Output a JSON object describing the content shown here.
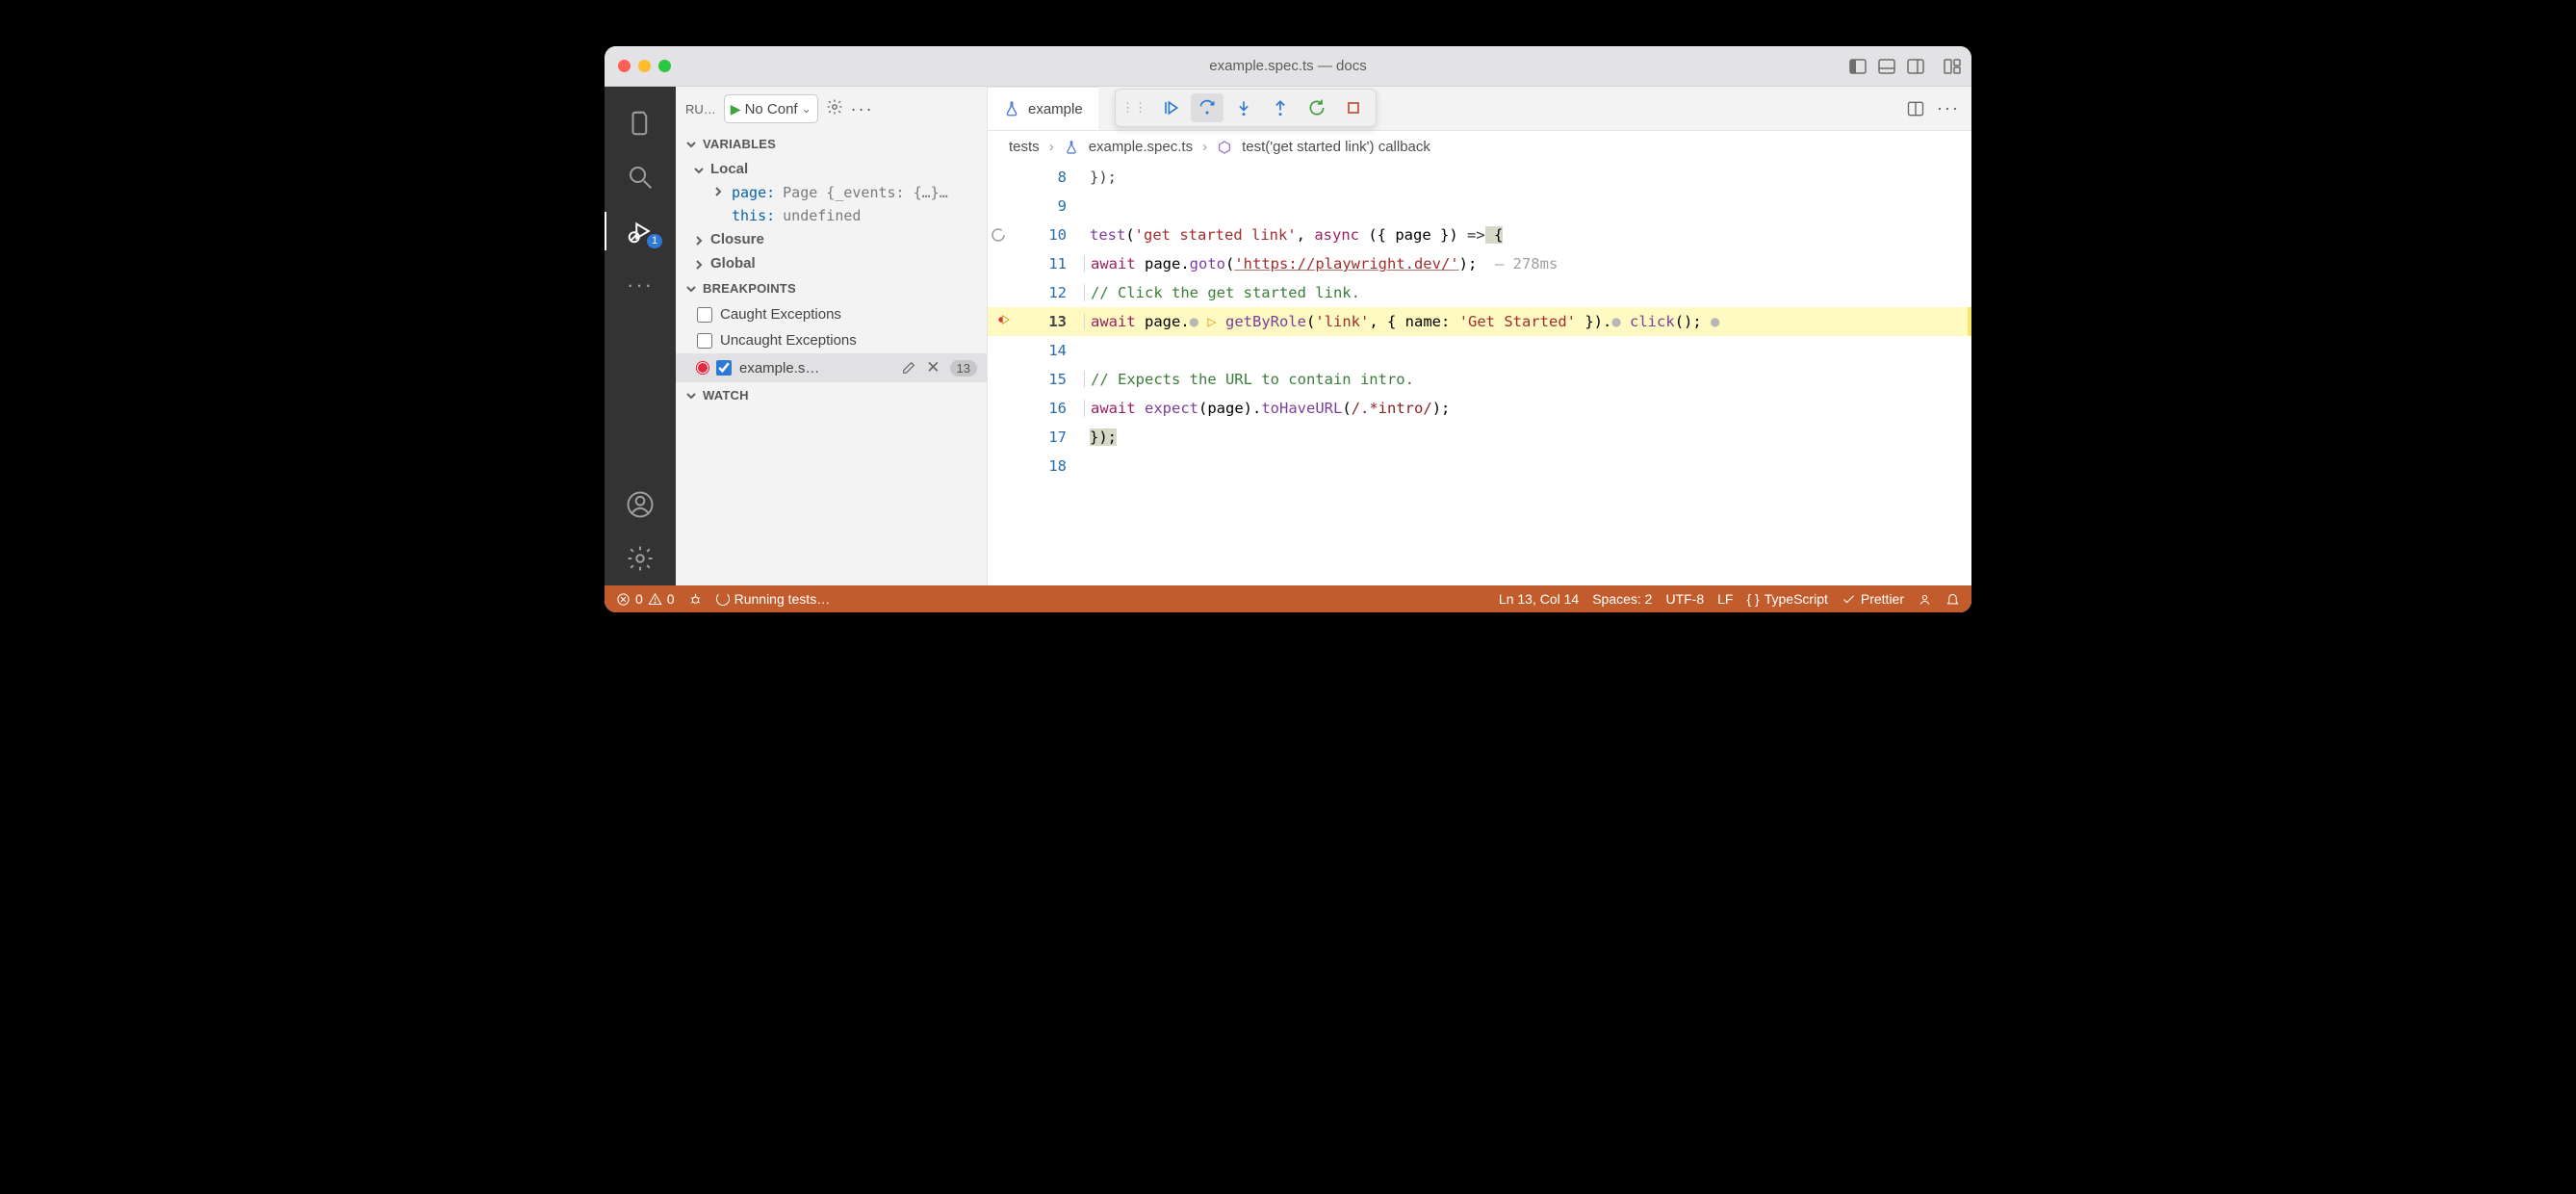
{
  "titlebar": {
    "title": "example.spec.ts — docs"
  },
  "activity": {
    "debug_badge": "1"
  },
  "sidepanel": {
    "run_label": "RU…",
    "config_label": "No Conf",
    "variables_title": "VARIABLES",
    "local_title": "Local",
    "vars": {
      "page_key": "page:",
      "page_val": "Page {_events: {…}…",
      "this_key": "this:",
      "this_val": "undefined"
    },
    "closure_title": "Closure",
    "global_title": "Global",
    "breakpoints_title": "BREAKPOINTS",
    "bp_caught": "Caught Exceptions",
    "bp_uncaught": "Uncaught Exceptions",
    "bp_file": "example.s…",
    "bp_line": "13",
    "watch_title": "WATCH"
  },
  "tab": {
    "label": "example"
  },
  "crumbs": {
    "a": "tests",
    "b": "example.spec.ts",
    "c": "test('get started link') callback"
  },
  "code": {
    "l8_num": "8",
    "l8": "});",
    "l9_num": "9",
    "l10_num": "10",
    "l10_fn": "test",
    "l10_str": "'get started link'",
    "l10_mid": ", ",
    "l10_kw": "async",
    "l10_rest": " ({ page }) ",
    "l10_arrow": "=>",
    "l10_brace": " {",
    "l11_num": "11",
    "l11_kw": "await",
    "l11_mid": " page.",
    "l11_fn": "goto",
    "l11_open": "(",
    "l11_str": "'https://playwright.dev/'",
    "l11_close": ");",
    "l11_timing": "  — 278ms",
    "l12_num": "12",
    "l12_cmt": "// Click the get started link.",
    "l13_num": "13",
    "l13_kw": "await",
    "l13_mid": " page.",
    "l13_fn": "getByRole",
    "l13_args_pre": "(",
    "l13_str1": "'link'",
    "l13_args_mid": ", { name: ",
    "l13_str2": "'Get Started'",
    "l13_args_end": " }).",
    "l13_fn2": "click",
    "l13_end": "();",
    "l14_num": "14",
    "l15_num": "15",
    "l15_cmt": "// Expects the URL to contain intro.",
    "l16_num": "16",
    "l16_kw": "await",
    "l16_a": " ",
    "l16_fn1": "expect",
    "l16_b": "(page).",
    "l16_fn2": "toHaveURL",
    "l16_c": "(",
    "l16_rgx": "/.*intro/",
    "l16_d": ");",
    "l17_num": "17",
    "l17": "});",
    "l18_num": "18"
  },
  "status": {
    "errors": "0",
    "warnings": "0",
    "running": "Running tests…",
    "pos": "Ln 13, Col 14",
    "spaces": "Spaces: 2",
    "enc": "UTF-8",
    "eol": "LF",
    "lang": "TypeScript",
    "prettier": "Prettier"
  }
}
